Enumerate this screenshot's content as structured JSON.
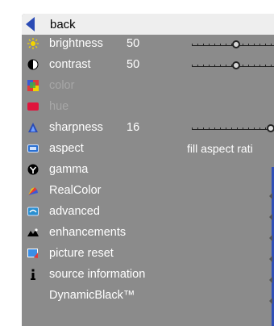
{
  "menu": {
    "back_label": "back",
    "items": [
      {
        "label": "brightness",
        "value": "50",
        "slider": 0.5,
        "icon": "sun-icon",
        "disabled": false
      },
      {
        "label": "contrast",
        "value": "50",
        "slider": 0.5,
        "icon": "contrast-icon",
        "disabled": false
      },
      {
        "label": "color",
        "value": "",
        "icon": "color-palette-icon",
        "disabled": true
      },
      {
        "label": "hue",
        "value": "",
        "icon": "hue-icon",
        "disabled": true
      },
      {
        "label": "sharpness",
        "value": "16",
        "slider": 0.89,
        "icon": "sharpness-icon",
        "disabled": false
      },
      {
        "label": "aspect",
        "value": "",
        "option": "fill aspect rati",
        "icon": "aspect-icon",
        "disabled": false
      },
      {
        "label": "gamma",
        "value": "",
        "icon": "gamma-icon",
        "disabled": false
      },
      {
        "label": "RealColor",
        "value": "",
        "icon": "realcolor-icon",
        "disabled": false
      },
      {
        "label": "advanced",
        "value": "",
        "icon": "advanced-icon",
        "disabled": false
      },
      {
        "label": "enhancements",
        "value": "",
        "icon": "enhancements-icon",
        "disabled": false
      },
      {
        "label": "picture reset",
        "value": "",
        "icon": "picture-reset-icon",
        "disabled": false
      },
      {
        "label": "source information",
        "value": "",
        "icon": "info-icon",
        "disabled": false
      },
      {
        "label": "DynamicBlack™",
        "value": "",
        "icon": "",
        "disabled": false
      }
    ]
  },
  "colors": {
    "panel_bg": "#8b8b8b",
    "selected_bg": "#eeeeee",
    "accent": "#2a4bb5"
  }
}
